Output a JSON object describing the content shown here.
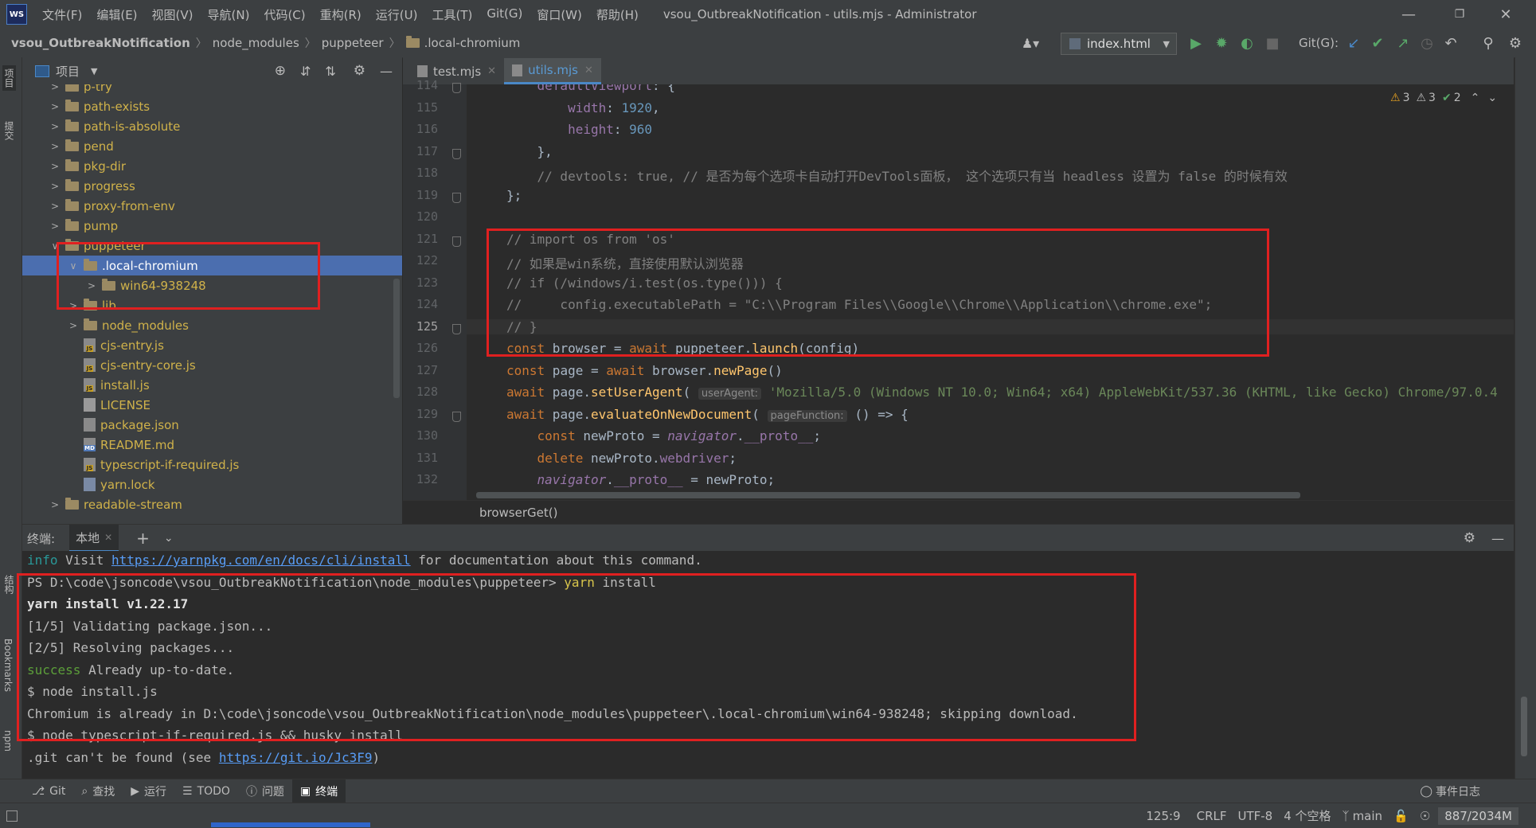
{
  "app": {
    "icon_text": "WS"
  },
  "menu": [
    "文件(F)",
    "编辑(E)",
    "视图(V)",
    "导航(N)",
    "代码(C)",
    "重构(R)",
    "运行(U)",
    "工具(T)",
    "Git(G)",
    "窗口(W)",
    "帮助(H)"
  ],
  "window_title": "vsou_OutbreakNotification - utils.mjs - Administrator",
  "breadcrumbs": [
    "vsou_OutbreakNotification",
    "node_modules",
    "puppeteer",
    ".local-chromium"
  ],
  "run_config": "index.html",
  "git_label": "Git(G):",
  "left_strip": {
    "project": "项目",
    "commit": "提交",
    "structure": "结构",
    "bookmarks": "Bookmarks",
    "npm": "npm"
  },
  "project_panel": {
    "title": "项目"
  },
  "tree": [
    {
      "label": "p-try",
      "type": "folder",
      "depth": 1,
      "expand": "closed"
    },
    {
      "label": "path-exists",
      "type": "folder",
      "depth": 1,
      "expand": "closed"
    },
    {
      "label": "path-is-absolute",
      "type": "folder",
      "depth": 1,
      "expand": "closed"
    },
    {
      "label": "pend",
      "type": "folder",
      "depth": 1,
      "expand": "closed"
    },
    {
      "label": "pkg-dir",
      "type": "folder",
      "depth": 1,
      "expand": "closed"
    },
    {
      "label": "progress",
      "type": "folder",
      "depth": 1,
      "expand": "closed"
    },
    {
      "label": "proxy-from-env",
      "type": "folder",
      "depth": 1,
      "expand": "closed"
    },
    {
      "label": "pump",
      "type": "folder",
      "depth": 1,
      "expand": "closed"
    },
    {
      "label": "puppeteer",
      "type": "folder",
      "depth": 1,
      "expand": "open"
    },
    {
      "label": ".local-chromium",
      "type": "folder",
      "depth": 2,
      "expand": "open",
      "selected": true
    },
    {
      "label": "win64-938248",
      "type": "folder",
      "depth": 3,
      "expand": "closed"
    },
    {
      "label": "lib",
      "type": "folder",
      "depth": 2,
      "expand": "closed"
    },
    {
      "label": "node_modules",
      "type": "folder",
      "depth": 2,
      "expand": "closed"
    },
    {
      "label": "cjs-entry.js",
      "type": "js",
      "depth": 2,
      "expand": "none"
    },
    {
      "label": "cjs-entry-core.js",
      "type": "js",
      "depth": 2,
      "expand": "none"
    },
    {
      "label": "install.js",
      "type": "js",
      "depth": 2,
      "expand": "none"
    },
    {
      "label": "LICENSE",
      "type": "txt",
      "depth": 2,
      "expand": "none"
    },
    {
      "label": "package.json",
      "type": "json",
      "depth": 2,
      "expand": "none"
    },
    {
      "label": "README.md",
      "type": "md",
      "depth": 2,
      "expand": "none"
    },
    {
      "label": "typescript-if-required.js",
      "type": "js",
      "depth": 2,
      "expand": "none"
    },
    {
      "label": "yarn.lock",
      "type": "lock",
      "depth": 2,
      "expand": "none"
    },
    {
      "label": "readable-stream",
      "type": "folder",
      "depth": 1,
      "expand": "closed"
    }
  ],
  "editor_tabs": [
    {
      "label": "test.mjs",
      "active": false
    },
    {
      "label": "utils.mjs",
      "active": true
    }
  ],
  "inspections": {
    "warnings": "3",
    "weak_warnings": "3",
    "ok": "2"
  },
  "code_lines": [
    {
      "n": "114",
      "html": "    <span class='prop'>defaultViewport</span>: {"
    },
    {
      "n": "115",
      "html": "        <span class='prop'>width</span>: <span class='num'>1920</span>,"
    },
    {
      "n": "116",
      "html": "        <span class='prop'>height</span>: <span class='num'>960</span>"
    },
    {
      "n": "117",
      "html": "    },"
    },
    {
      "n": "118",
      "html": "    <span class='cmt'>// devtools: true, // 是否为每个选项卡自动打开DevTools面板， 这个选项只有当 headless 设置为 false 的时候有效</span>"
    },
    {
      "n": "119",
      "html": "};"
    },
    {
      "n": "120",
      "html": ""
    },
    {
      "n": "121",
      "html": "<span class='cmt'>// import os from 'os'</span>"
    },
    {
      "n": "122",
      "html": "<span class='cmt'>// 如果是win系统，直接使用默认浏览器</span>"
    },
    {
      "n": "123",
      "html": "<span class='cmt'>// if (/windows/i.test(os.type())) {</span>"
    },
    {
      "n": "124",
      "html": "<span class='cmt'>//     config.executablePath = \"C:\\\\Program Files\\\\Google\\\\Chrome\\\\Application\\\\chrome.exe\";</span>"
    },
    {
      "n": "125",
      "html": "<span class='cmt'>// }</span>"
    },
    {
      "n": "126",
      "html": "<span class='kw'>const</span> browser = <span class='kw'>await</span> puppeteer.<span class='fn'>launch</span>(config)"
    },
    {
      "n": "127",
      "html": "<span class='kw'>const</span> page = <span class='kw'>await</span> browser.<span class='fn'>newPage</span>()"
    },
    {
      "n": "128",
      "html": "<span class='kw'>await</span> page.<span class='fn'>setUserAgent</span>( <span class='hint'>userAgent:</span> <span class='str'>'Mozilla/5.0 (Windows NT 10.0; Win64; x64) AppleWebKit/537.36 (KHTML, like Gecko) Chrome/97.0.4</span>"
    },
    {
      "n": "129",
      "html": "<span class='kw'>await</span> page.<span class='fn'>evaluateOnNewDocument</span>( <span class='hint'>pageFunction:</span> () => {"
    },
    {
      "n": "130",
      "html": "    <span class='kw'>const</span> newProto = <span class='it'>navigator</span>.<span class='prop'>__proto__</span>;"
    },
    {
      "n": "131",
      "html": "    <span class='kw'>delete</span> newProto.<span class='prop'>webdriver</span>;"
    },
    {
      "n": "132",
      "html": "    <span class='it'>navigator</span>.<span class='prop'>__proto__</span> = newProto;"
    }
  ],
  "function_crumb": "browserGet()",
  "terminal": {
    "label": "终端:",
    "tab": "本地"
  },
  "terminal_lines": [
    {
      "html": "<span class='cyan'>info</span> Visit <a>https://yarnpkg.com/en/docs/cli/install</a> for documentation about this command."
    },
    {
      "html": "PS D:\\code\\jsoncode\\vsou_OutbreakNotification\\node_modules\\puppeteer> <span class='yellow'>yarn</span> install"
    },
    {
      "html": "<span class='bold'>yarn install v1.22.17</span>"
    },
    {
      "html": "[1/5] Validating package.json..."
    },
    {
      "html": "[2/5] Resolving packages..."
    },
    {
      "html": "<span class='green'>success</span> Already up-to-date."
    },
    {
      "html": "$ node install.js"
    },
    {
      "html": "Chromium is already in D:\\code\\jsoncode\\vsou_OutbreakNotification\\node_modules\\puppeteer\\.local-chromium\\win64-938248; skipping download."
    },
    {
      "html": "$ node typescript-if-required.js && husky install"
    },
    {
      "html": ".git can't be found (see <a>https://git.io/Jc3F9</a>)"
    }
  ],
  "bottom_tools": [
    "Git",
    "查找",
    "运行",
    "TODO",
    "问题",
    "终端"
  ],
  "event_log": "事件日志",
  "status": {
    "position": "125:9",
    "line_sep": "CRLF",
    "encoding": "UTF-8",
    "indent": "4 个空格",
    "branch": "main",
    "memory": "887/2034M"
  }
}
